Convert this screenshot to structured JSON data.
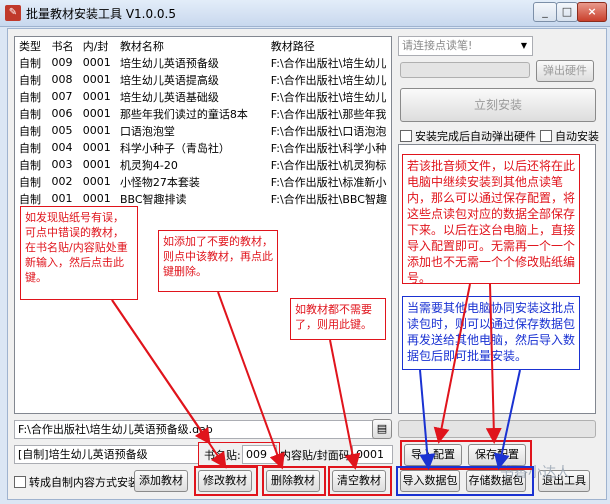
{
  "window": {
    "title": "批量教材安装工具 V1.0.0.5",
    "controls": [
      "_",
      "□",
      "×"
    ]
  },
  "table": {
    "headers": [
      "类型",
      "书名",
      "内/封",
      "教材名称",
      "教材路径"
    ],
    "rows": [
      [
        "自制",
        "009",
        "0001",
        "培生幼儿英语预备级",
        "F:\\合作出版社\\培生幼儿"
      ],
      [
        "自制",
        "008",
        "0001",
        "培生幼儿英语提高级",
        "F:\\合作出版社\\培生幼儿"
      ],
      [
        "自制",
        "007",
        "0001",
        "培生幼儿英语基础级",
        "F:\\合作出版社\\培生幼儿"
      ],
      [
        "自制",
        "006",
        "0001",
        "那些年我们读过的童话8本",
        "F:\\合作出版社\\那些年我"
      ],
      [
        "自制",
        "005",
        "0001",
        "口语泡泡堂",
        "F:\\合作出版社\\口语泡泡"
      ],
      [
        "自制",
        "004",
        "0001",
        "科学小种子（青岛社）",
        "F:\\合作出版社\\科学小种"
      ],
      [
        "自制",
        "003",
        "0001",
        "机灵狗4-20",
        "F:\\合作出版社\\机灵狗标"
      ],
      [
        "自制",
        "002",
        "0001",
        "小怪物27本套装",
        "F:\\合作出版社\\标准新小"
      ],
      [
        "自制",
        "001",
        "0001",
        "BBC智趣排读",
        "F:\\合作出版社\\BBC智趣"
      ]
    ]
  },
  "path_bar": {
    "value": "F:\\合作出版社\\培生幼儿英语预备级.dab",
    "browse_icon": "folder-icon"
  },
  "selected_line": {
    "text": "[自制]培生幼儿英语预备级",
    "book_label": "书名贴:",
    "book_value": "009",
    "code_label": "内容贴/封面码:",
    "code_value": "0001"
  },
  "bottom": {
    "convert_checkbox": "转成自制内容方式安装",
    "add_btn": "添加教材",
    "edit_btn": "修改教材",
    "delete_btn": "删除教材",
    "clear_btn": "清空教材",
    "import_pkg_btn": "导入数据包",
    "save_pkg_btn": "存储数据包",
    "exit_btn": "退出工具"
  },
  "right": {
    "pen_select_placeholder": "请连接点读笔!",
    "eject_btn": "弹出硬件",
    "install_btn": "立刻安装",
    "auto_eject_label": "安装完成后自动弹出硬件",
    "auto_install_label": "自动安装",
    "import_cfg_btn": "导入配置",
    "save_cfg_btn": "保存配置"
  },
  "notes": {
    "note_phone": "如发现贴纸号有误，可点中错误的教材，在书名贴/内容贴处重新输入，然后点击此键。",
    "note_delete": "如添加了不要的教材，则点中该教材，再点此键删除。",
    "note_clear": "如教材都不需要了，则用此键。",
    "note_save_cfg": "若该批音频文件，以后还将在此电脑中继续安装到其他点读笔内，那么可以通过保存配置，将这些点读包对应的数据全部保存下来。以后在这台电脑上，直接导入配置即可。无需再一个一个添加也不无需一个个修改贴纸编号。",
    "note_pkg": "当需要其他电脑协同安装这批点读包时，则可以通过保存数据包再发送给其他电脑，然后导入数据包后即可批量安装。"
  },
  "watermark": "书香小达人",
  "colors": {
    "annotation_red": "#e0141c",
    "annotation_blue": "#1a32d2",
    "title_bar": "#c8d8ee"
  }
}
